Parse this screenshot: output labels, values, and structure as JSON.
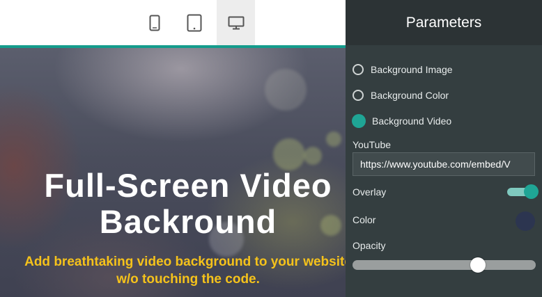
{
  "toolbar": {
    "devices": [
      {
        "name": "phone-icon",
        "active": false
      },
      {
        "name": "tablet-icon",
        "active": false
      },
      {
        "name": "desktop-icon",
        "active": true
      }
    ]
  },
  "hero": {
    "title": "Full-Screen Video\nBackround",
    "subtitle": "Add breathtaking video background to your  website\nw/o touching the code."
  },
  "panel": {
    "title": "Parameters",
    "background_options": [
      {
        "label": "Background Image",
        "checked": false
      },
      {
        "label": "Background Color",
        "checked": false
      },
      {
        "label": "Background Video",
        "checked": true
      }
    ],
    "youtube_label": "YouTube",
    "youtube_value": "https://www.youtube.com/embed/V",
    "overlay_label": "Overlay",
    "overlay_on": true,
    "color_label": "Color",
    "color_value": "#2c3550",
    "opacity_label": "Opacity",
    "opacity_value": 0.7
  },
  "colors": {
    "accent": "#149c8c",
    "subtitle": "#f5c21b",
    "panel_bg": "#343e40"
  }
}
